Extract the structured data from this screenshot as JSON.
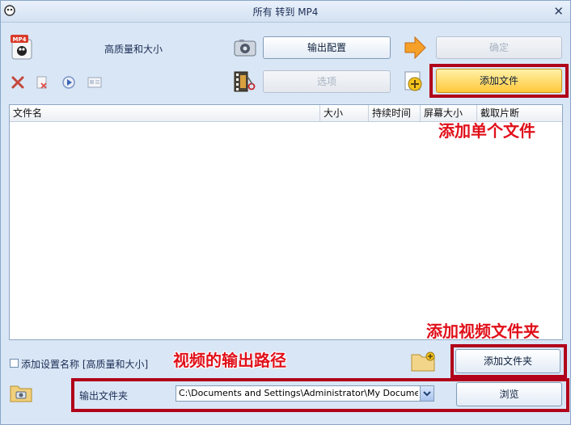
{
  "window": {
    "title": "所有 转到 MP4"
  },
  "profile": {
    "label": "高质量和大小",
    "format_badge": "MP4"
  },
  "buttons": {
    "output_config": "输出配置",
    "ok": "确定",
    "options": "选项",
    "add_file": "添加文件",
    "add_folder": "添加文件夹",
    "browse": "浏览"
  },
  "file_list": {
    "columns": [
      "文件名",
      "大小",
      "持续时间",
      "屏幕大小",
      "截取片断"
    ]
  },
  "bottom": {
    "add_setting_name": "添加设置名称 [高质量和大小]",
    "add_setting_checked": false,
    "output_folder_label": "输出文件夹",
    "output_path": "C:\\Documents and Settings\\Administrator\\My Documents\\FFOutput"
  },
  "annotations": {
    "add_single_file": "添加单个文件",
    "add_video_folder": "添加视频文件夹",
    "video_output_path": "视频的输出路径"
  },
  "colors": {
    "annotation": "#e0101a",
    "highlight_box": "#b0001a",
    "primary_orange": "#ffc83a"
  }
}
